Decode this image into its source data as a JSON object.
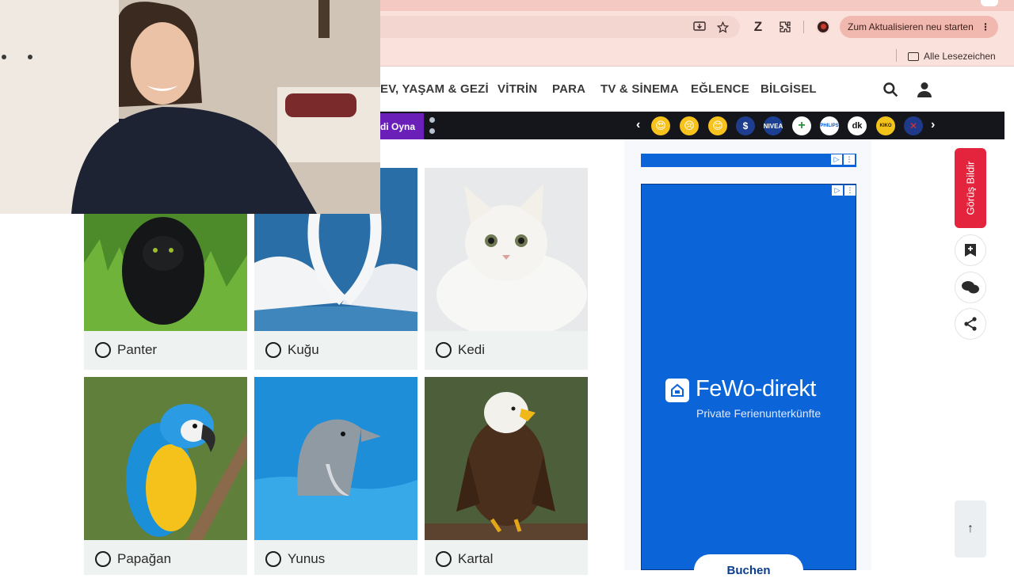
{
  "browser": {
    "restart_button": "Zum Aktualisieren neu starten",
    "bookmarks_label": "Alle Lesezeichen"
  },
  "nav": {
    "items": [
      "EV, YAŞAM & GEZİ",
      "VİTRİN",
      "PARA",
      "TV & SİNEMA",
      "EĞLENCE",
      "BİLGİSEL"
    ]
  },
  "strip": {
    "play_label": "di Oyna",
    "emojis": [
      "heart-eyes-emoji",
      "sad-emoji",
      "smile-emoji"
    ],
    "brands": [
      "$",
      "NIVEA",
      "+",
      "PHILIPS",
      "dk",
      "KIKO",
      "✕"
    ]
  },
  "quiz": {
    "options": [
      {
        "label": "Panter"
      },
      {
        "label": "Kuğu"
      },
      {
        "label": "Kedi"
      },
      {
        "label": "Papağan"
      },
      {
        "label": "Yunus"
      },
      {
        "label": "Kartal"
      }
    ]
  },
  "ad": {
    "brand": "FeWo-direkt",
    "tagline": "Private Ferienunterkünfte",
    "button": "Buchen"
  },
  "sidebar": {
    "feedback": "Görüş Bildir"
  },
  "colors": {
    "accent_red": "#e4233d",
    "ad_blue": "#0b65d8",
    "play_purple": "#6a1fb8"
  }
}
